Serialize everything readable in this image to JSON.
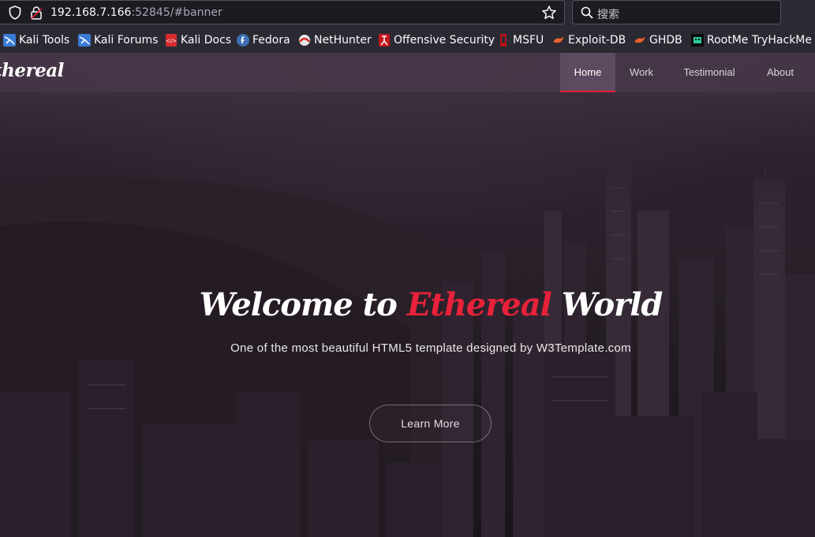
{
  "browser": {
    "url_host": "192.168.7.166",
    "url_rest": ":52845/#banner",
    "search_placeholder": "搜索"
  },
  "bookmarks": [
    {
      "label": "Kali Tools",
      "icon": "kali-icon"
    },
    {
      "label": "Kali Forums",
      "icon": "kali-icon"
    },
    {
      "label": "Kali Docs",
      "icon": "kali-docs-icon"
    },
    {
      "label": "Fedora",
      "icon": "fedora-icon"
    },
    {
      "label": "NetHunter",
      "icon": "nethunter-icon"
    },
    {
      "label": "Offensive Security",
      "icon": "offsec-icon"
    },
    {
      "label": "MSFU",
      "icon": "msfu-icon"
    },
    {
      "label": "Exploit-DB",
      "icon": "exploitdb-icon"
    },
    {
      "label": "GHDB",
      "icon": "ghdb-icon"
    },
    {
      "label": "RootMe TryHackMe W",
      "icon": "rootme-icon"
    }
  ],
  "site": {
    "logo": "thereal",
    "nav": [
      "Home",
      "Work",
      "Testimonial",
      "About"
    ],
    "active_nav": "Home",
    "hero": {
      "title_pre": "Welcome to ",
      "title_accent": "Ethereal",
      "title_post": " World",
      "subtitle": "One of the most beautiful HTML5 template designed by W3Template.com",
      "button": "Learn More"
    }
  },
  "colors": {
    "accent": "#e8223a",
    "navbar": "#463748",
    "browser_chrome": "#2b2a33"
  }
}
